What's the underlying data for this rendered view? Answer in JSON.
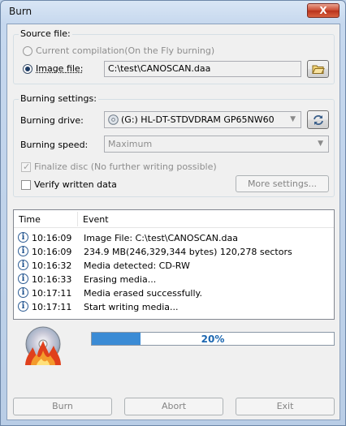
{
  "window": {
    "title": "Burn",
    "close_label": "X"
  },
  "source": {
    "group_label": "Source file:",
    "current_compilation_label": "Current compilation(On the Fly burning)",
    "image_file_label": "Image file:",
    "image_file_value": "C:\\test\\CANOSCAN.daa"
  },
  "settings": {
    "group_label": "Burning settings:",
    "drive_label": "Burning drive:",
    "drive_value": "(G:) HL-DT-STDVDRAM GP65NW60",
    "speed_label": "Burning speed:",
    "speed_value": "Maximum",
    "finalize_label": "Finalize disc (No further writing possible)",
    "verify_label": "Verify written data",
    "more_settings_label": "More settings..."
  },
  "log": {
    "columns": [
      "Time",
      "Event"
    ],
    "rows": [
      {
        "time": "10:16:09",
        "event": "Image File:  C:\\test\\CANOSCAN.daa"
      },
      {
        "time": "10:16:09",
        "event": "234.9 MB(246,329,344 bytes)  120,278 sectors"
      },
      {
        "time": "10:16:32",
        "event": "Media detected: CD-RW"
      },
      {
        "time": "10:16:33",
        "event": "Erasing media..."
      },
      {
        "time": "10:17:11",
        "event": "Media erased successfully."
      },
      {
        "time": "10:17:11",
        "event": "Start writing media..."
      }
    ]
  },
  "progress": {
    "percent_value": 20,
    "percent_label": "20%"
  },
  "buttons": {
    "burn": "Burn",
    "abort": "Abort",
    "exit": "Exit"
  },
  "colors": {
    "progress_fill": "#3b8bd5",
    "title_bar": "#c6d8ee"
  }
}
